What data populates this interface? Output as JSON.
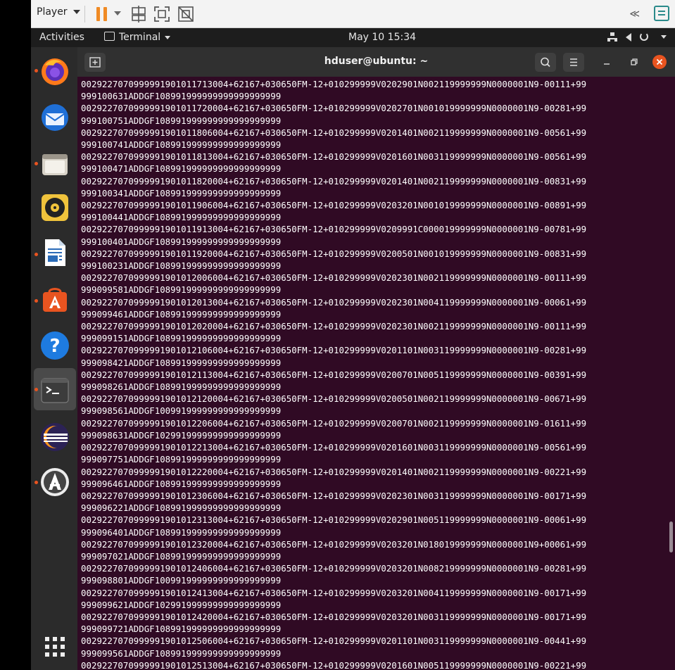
{
  "player_toolbar": {
    "menu_label": "Player",
    "icons": [
      "pause-icon",
      "send-keys-icon",
      "fullscreen-icon",
      "unity-icon",
      "back-icon",
      "notes-icon"
    ],
    "back_label": "≪"
  },
  "top_bar": {
    "activities": "Activities",
    "app_menu": "Terminal",
    "clock": "May 10  15:34",
    "icons": [
      "network-icon",
      "volume-icon",
      "power-icon"
    ]
  },
  "dock": {
    "items": [
      "firefox",
      "thunderbird",
      "files",
      "rhythmbox",
      "libreoffice-writer",
      "ubuntu-software",
      "help",
      "terminal",
      "eclipse",
      "software-updater",
      "show-apps"
    ]
  },
  "terminal": {
    "title": "hduser@ubuntu: ~",
    "lines": [
      "0029227070999991901011713004+62167+030650FM-12+010299999V0202901N002119999999N0000001N9-00111+99",
      "999100631ADDGF108991999999999999999999",
      "0029227070999991901011720004+62167+030650FM-12+010299999V0202701N001019999999N0000001N9-00281+99",
      "999100751ADDGF108991999999999999999999",
      "0029227070999991901011806004+62167+030650FM-12+010299999V0201401N002119999999N0000001N9-00561+99",
      "999100741ADDGF108991999999999999999999",
      "0029227070999991901011813004+62167+030650FM-12+010299999V0201601N003119999999N0000001N9-00561+99",
      "999100471ADDGF108991999999999999999999",
      "0029227070999991901011820004+62167+030650FM-12+010299999V0201401N002119999999N0000001N9-00831+99",
      "999100341ADDGF108991999999999999999999",
      "0029227070999991901011906004+62167+030650FM-12+010299999V0203201N001019999999N0000001N9-00891+99",
      "999100441ADDGF108991999999999999999999",
      "0029227070999991901011913004+62167+030650FM-12+010299999V0209991C000019999999N0000001N9-00781+99",
      "999100401ADDGF108991999999999999999999",
      "0029227070999991901011920004+62167+030650FM-12+010299999V0200501N001019999999N0000001N9-00831+99",
      "999100231ADDGF108991999999999999999999",
      "0029227070999991901012006004+62167+030650FM-12+010299999V0202301N002119999999N0000001N9-00111+99",
      "999099581ADDGF108991999999999999999999",
      "0029227070999991901012013004+62167+030650FM-12+010299999V0202301N004119999999N0000001N9-00061+99",
      "999099461ADDGF108991999999999999999999",
      "0029227070999991901012020004+62167+030650FM-12+010299999V0202301N002119999999N0000001N9-00111+99",
      "999099151ADDGF108991999999999999999999",
      "0029227070999991901012106004+62167+030650FM-12+010299999V0201101N003119999999N0000001N9-00281+99",
      "999098421ADDGF108991999999999999999999",
      "0029227070999991901012113004+62167+030650FM-12+010299999V0200701N005119999999N0000001N9-00391+99",
      "999098261ADDGF108991999999999999999999",
      "0029227070999991901012120004+62167+030650FM-12+010299999V0200501N002119999999N0000001N9-00671+99",
      "999098561ADDGF100991999999999999999999",
      "0029227070999991901012206004+62167+030650FM-12+010299999V0200701N002119999999N0000001N9-01611+99",
      "999098631ADDGF102991999999999999999999",
      "0029227070999991901012213004+62167+030650FM-12+010299999V0201601N003119999999N0000001N9-00561+99",
      "999097751ADDGF108991999999999999999999",
      "0029227070999991901012220004+62167+030650FM-12+010299999V0201401N002119999999N0000001N9-00221+99",
      "999096461ADDGF108991999999999999999999",
      "0029227070999991901012306004+62167+030650FM-12+010299999V0202301N003119999999N0000001N9-00171+99",
      "999096221ADDGF108991999999999999999999",
      "0029227070999991901012313004+62167+030650FM-12+010299999V0202901N005119999999N0000001N9-00061+99",
      "999096401ADDGF108991999999999999999999",
      "0029227070999991901012320004+62167+030650FM-12+010299999V0203201N018019999999N0000001N9+00061+99",
      "999097021ADDGF108991999999999999999999",
      "0029227070999991901012406004+62167+030650FM-12+010299999V0203201N008219999999N0000001N9-00281+99",
      "999098801ADDGF100991999999999999999999",
      "0029227070999991901012413004+62167+030650FM-12+010299999V0203201N004119999999N0000001N9-00171+99",
      "999099621ADDGF102991999999999999999999",
      "0029227070999991901012420004+62167+030650FM-12+010299999V0203201N003119999999N0000001N9-00171+99",
      "999099721ADDGF108991999999999999999999",
      "0029227070999991901012506004+62167+030650FM-12+010299999V0201101N003119999999N0000001N9-00441+99",
      "999099561ADDGF108991999999999999999999",
      "0029227070999991901012513004+62167+030650FM-12+010299999V0201601N005119999999N0000001N9-00221+99"
    ]
  },
  "colors": {
    "terminal_bg": "#300a24",
    "accent": "#e95420",
    "pause": "#f08a24"
  }
}
